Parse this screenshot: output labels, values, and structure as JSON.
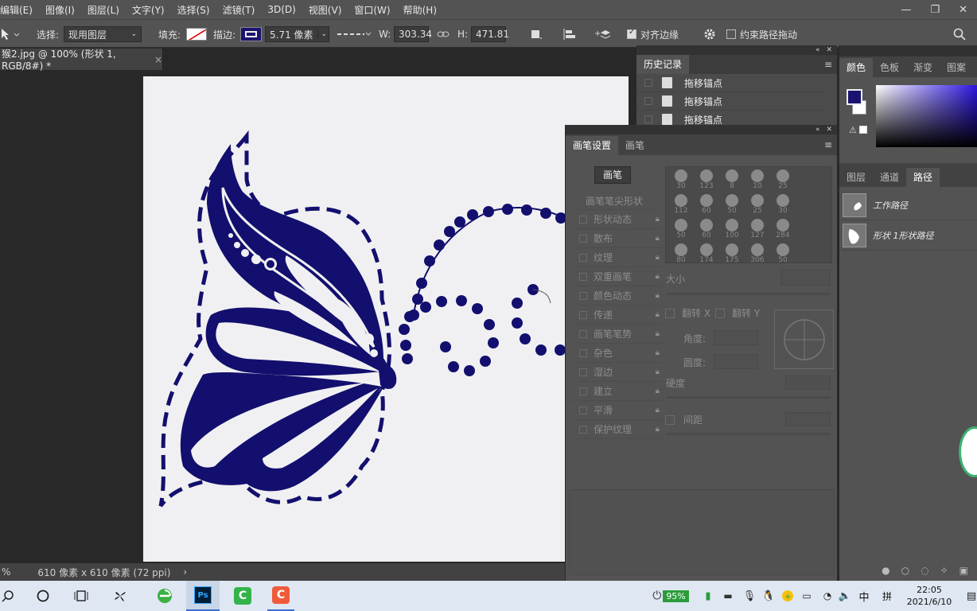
{
  "menu": [
    "编辑(E)",
    "图像(I)",
    "图层(L)",
    "文字(Y)",
    "选择(S)",
    "滤镜(T)",
    "3D(D)",
    "视图(V)",
    "窗口(W)",
    "帮助(H)"
  ],
  "options": {
    "select_label": "选择:",
    "select_value": "现用图层",
    "fill_label": "填充:",
    "stroke_label": "描边:",
    "stroke_width": "5.71 像素",
    "w_label": "W:",
    "w_value": "303.34",
    "h_label": "H:",
    "h_value": "471.81",
    "align_edges": "对齐边缘",
    "constrain_path": "约束路径拖动"
  },
  "doc_tab": {
    "title": "猴2.jpg @ 100% (形状 1, RGB/8#) *",
    "close": "×"
  },
  "status": {
    "zoom": "%",
    "info": "610 像素 x 610 像素 (72 ppi)",
    "arrow": "›"
  },
  "history": {
    "tab": "历史记录",
    "items": [
      "拖移锚点",
      "拖移锚点",
      "拖移锚点"
    ]
  },
  "brush": {
    "tabs": [
      "画笔设置",
      "画笔"
    ],
    "brush_button": "画笔",
    "tip_shape": "画笔笔尖形状",
    "options": [
      "形状动态",
      "散布",
      "纹理",
      "双重画笔",
      "颜色动态",
      "传递",
      "画笔笔势",
      "杂色",
      "湿边",
      "建立",
      "平滑",
      "保护纹理"
    ],
    "presets": [
      [
        "30",
        "123",
        "8",
        "10",
        "25"
      ],
      [
        "112",
        "60",
        "50",
        "25",
        "30"
      ],
      [
        "50",
        "60",
        "100",
        "127",
        "284"
      ],
      [
        "80",
        "174",
        "175",
        "306",
        "50"
      ]
    ],
    "size_label": "大小",
    "flip_x": "翻转 X",
    "flip_y": "翻转 Y",
    "angle_label": "角度:",
    "roundness_label": "圆度:",
    "hardness_label": "硬度",
    "spacing_label": "间距"
  },
  "color_panel": {
    "tabs": [
      "颜色",
      "色板",
      "渐变",
      "图案"
    ],
    "fg": "#1a1470",
    "bg": "#ffffff"
  },
  "paths_panel": {
    "tabs": [
      "图层",
      "通道",
      "路径"
    ],
    "items": [
      "工作路径",
      "形状 1形状路径"
    ]
  },
  "taskbar": {
    "battery": "95%",
    "ime": "中",
    "ime2": "拼",
    "time": "22:05",
    "date": "2021/6/10"
  },
  "colors": {
    "butterfly": "#130f6e",
    "canvas": "#f0f0f2",
    "panel": "#535353"
  }
}
